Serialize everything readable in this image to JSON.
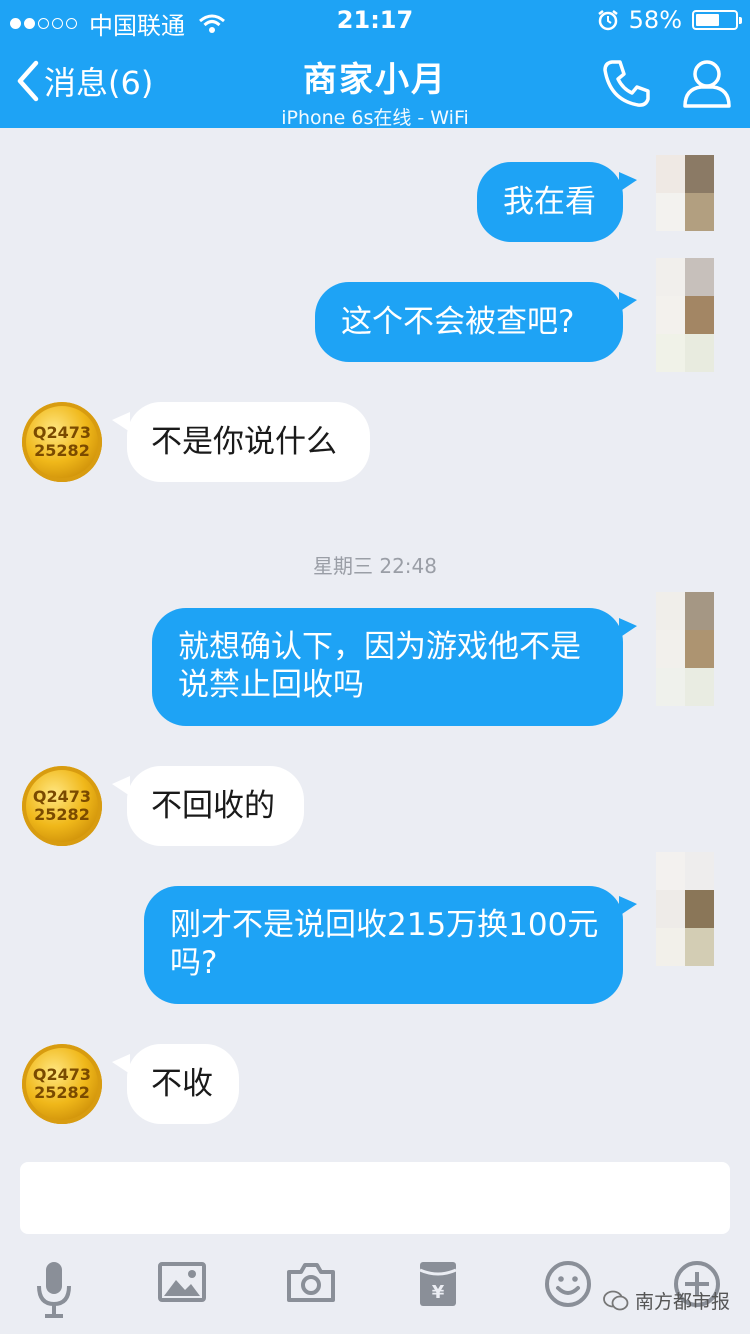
{
  "status_bar": {
    "carrier": "中国联通",
    "time": "21:17",
    "battery": "58%",
    "battery_level": 0.58
  },
  "nav": {
    "back_label": "消息(6)",
    "title": "商家小月",
    "subtitle": "iPhone 6s在线 - WiFi",
    "icons": [
      "phone-icon",
      "profile-icon"
    ]
  },
  "avatar_text": {
    "line1": "Q2473",
    "line2": "25282"
  },
  "messages": [
    {
      "side": "out",
      "text": "我在看"
    },
    {
      "side": "out",
      "text": "这个不会被查吧?"
    },
    {
      "side": "in",
      "text": "不是你说什么"
    },
    {
      "side": "out",
      "text": "就想确认下，因为游戏他不是说禁止回收吗"
    },
    {
      "side": "in",
      "text": "不回收的"
    },
    {
      "side": "out",
      "text": "刚才不是说回收215万换100元吗?"
    },
    {
      "side": "in",
      "text": "不收"
    }
  ],
  "timestamp": "星期三 22:48",
  "input": {
    "value": ""
  },
  "toolbar_icons": [
    "microphone-icon",
    "image-icon",
    "camera-icon",
    "red-packet-icon",
    "emoji-icon",
    "plus-icon"
  ],
  "watermark": "南方都市报",
  "colors": {
    "accent": "#1ea3f5",
    "background": "#ebedf3",
    "incoming_bubble": "#ffffff"
  }
}
